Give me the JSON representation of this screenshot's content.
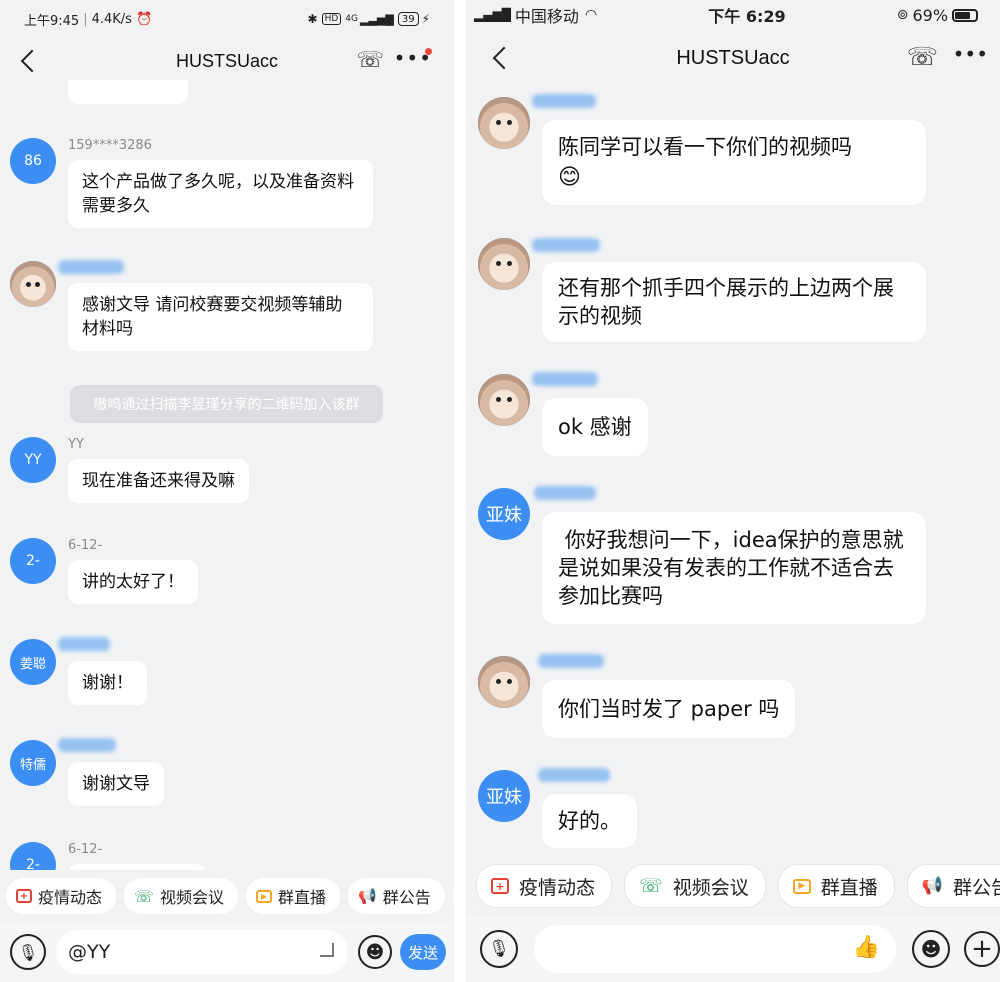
{
  "left": {
    "status": {
      "time": "上午9:45",
      "speed": "4.4K/s",
      "battery": "39",
      "network": "4G"
    },
    "title": "HUSTSUacc",
    "messages": [
      {
        "avatar": "86",
        "nick": "159****3286",
        "text": "这个产品做了多久呢，以及准备资料需要多久"
      },
      {
        "avatar": "",
        "nick": "",
        "text": "感谢文导 请问校赛要交视频等辅助材料吗"
      },
      {
        "avatar": "YY",
        "nick": "YY",
        "text": "现在准备还来得及嘛"
      },
      {
        "avatar": "2-",
        "nick": "6-12-",
        "text": "讲的太好了！"
      },
      {
        "avatar": "姜聪",
        "nick": "",
        "text": "谢谢！"
      },
      {
        "avatar": "特儒",
        "nick": "",
        "text": "谢谢文导"
      },
      {
        "avatar": "2-",
        "nick": "6-12-",
        "text": ""
      }
    ],
    "system_notice": "嗷呜通过扫描李昱瑾分享的二维码加入该群",
    "shortcuts": [
      "疫情动态",
      "视频会议",
      "群直播",
      "群公告"
    ],
    "input_value": "@YY",
    "send_label": "发送"
  },
  "right": {
    "status": {
      "carrier": "中国移动",
      "time": "下午 6:29",
      "battery": "69%"
    },
    "title": "HUSTSUacc",
    "messages": [
      {
        "avatar": "",
        "text": "陈同学可以看一下你们的视频吗",
        "emoji": "😊"
      },
      {
        "avatar": "",
        "text": "还有那个抓手四个展示的上边两个展示的视频"
      },
      {
        "avatar": "",
        "text": "ok 感谢"
      },
      {
        "avatar": "亚妹",
        "text": " 你好我想问一下，idea保护的意思就是说如果没有发表的工作就不适合去参加比赛吗"
      },
      {
        "avatar": "",
        "text": "你们当时发了 paper 吗"
      },
      {
        "avatar": "亚妹",
        "text": "好的。"
      }
    ],
    "shortcuts": [
      "疫情动态",
      "视频会议",
      "群直播",
      "群公告"
    ]
  },
  "colors": {
    "accent": "#3d8ef2",
    "background": "#f1f2f4",
    "bubble": "#ffffff"
  },
  "icons": [
    "back-icon",
    "video-call-icon",
    "more-icon",
    "mic-icon",
    "emoji-icon",
    "plus-icon",
    "thumbs-up-icon"
  ]
}
